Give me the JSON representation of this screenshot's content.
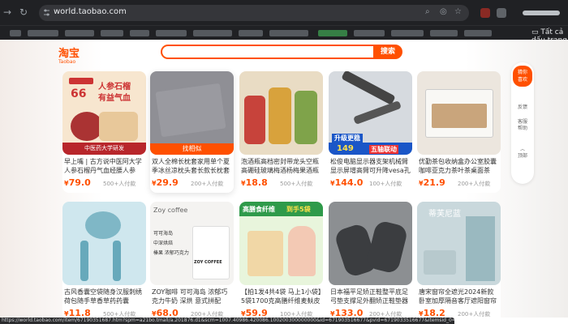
{
  "browser": {
    "url": "world.taobao.com",
    "bookmark_folder_label": "Tất cả dấu trang"
  },
  "header": {
    "logo_cn": "淘宝",
    "logo_en": "Taobao",
    "search_button": "搜索",
    "search_placeholder": ""
  },
  "products": [
    {
      "title": "早上嘴 | 古方说中医阿大学人参石榴丹气血经腰人参",
      "price": "79.0",
      "sales": "500+人付款",
      "img_text1": "人参石榴",
      "img_text2": "有益气血",
      "img_badge": "中医药大学研发",
      "img_price": "66"
    },
    {
      "title": "双人全棉长枕套家用单个夏季冰丝凉枕头套长款长枕套",
      "price": "29.9",
      "sales": "200+人付款",
      "similar": "找相似"
    },
    {
      "title": "泡酒瓶高档密封带龙头空瓶高硼硅玻璃梅酒杨梅果酒瓶",
      "price": "18.8",
      "sales": "500+人付款"
    },
    {
      "title": "松俊电脑显示器支架机械臂显示屏增高臂可升降vesa孔",
      "price": "144.0",
      "sales": "100+人付款",
      "img_text1": "升级更稳",
      "img_text2": "五轴联动",
      "img_price": "149"
    },
    {
      "title": "优勤茶包收纳盒办公室胶囊咖啡亚克力茶叶茶桌面茶",
      "price": "21.9",
      "sales": "200+人付款"
    },
    {
      "title": "古风香囊空袋随身汉服刺绣荷包随手草香草药药囊",
      "price": "11.8",
      "sales": "500+人付款"
    },
    {
      "title": "ZOY咖啡 可可海岛 浓郁巧克力牛奶 深烘 意式拼配",
      "price": "68.0",
      "sales": "200+人付款",
      "img_text1": "Zoy coffee",
      "img_text2": "可可海岛",
      "img_text3": "中深烘焙",
      "img_text4": "榛果 浓郁巧克力",
      "img_brand": "ZOY COFFEE"
    },
    {
      "title": "【拍1发4共4袋 马上1小袋】5袋1700克高膳纤维麦麸皮膳",
      "price": "59.9",
      "sales": "100+人付款",
      "img_text1": "高膳食纤维",
      "img_text2": "到手5袋"
    },
    {
      "title": "日本福平足矫正鞋整平底足弓垫支撑足外翻矫正鞋垫器",
      "price": "133.0",
      "sales": "200+人付款"
    },
    {
      "title": "唐宋窗帘全遮光2024新款卧室加厚隔音客厅遮阳窗帘",
      "price": "18.2",
      "sales": "200+人付款",
      "img_text1": "蒂芙尼蓝"
    }
  ],
  "sidebar": {
    "top_label_1": "猜你",
    "top_label_2": "喜欢",
    "item_feedback": "反馈",
    "item_service": "客服",
    "item_service_2": "帮助",
    "item_top": "顶部"
  },
  "status": {
    "link": "https://world.taobao.com/item/67190351687.htm?spm=a21bo.tmall/a.201876.d1&scm=1007.40986.420086.100200300000000&id=671903516677&pvid=6719033516677&itemsid_0=FdGrqIqfEmpz-0.a2141.241046.global_feeds.2&itemIds=719023516677&scm=1007.35313.250647.0&reqionsr=GLOBAL"
  },
  "colors": {
    "accent": "#ff5000",
    "chrome": "#202124"
  }
}
